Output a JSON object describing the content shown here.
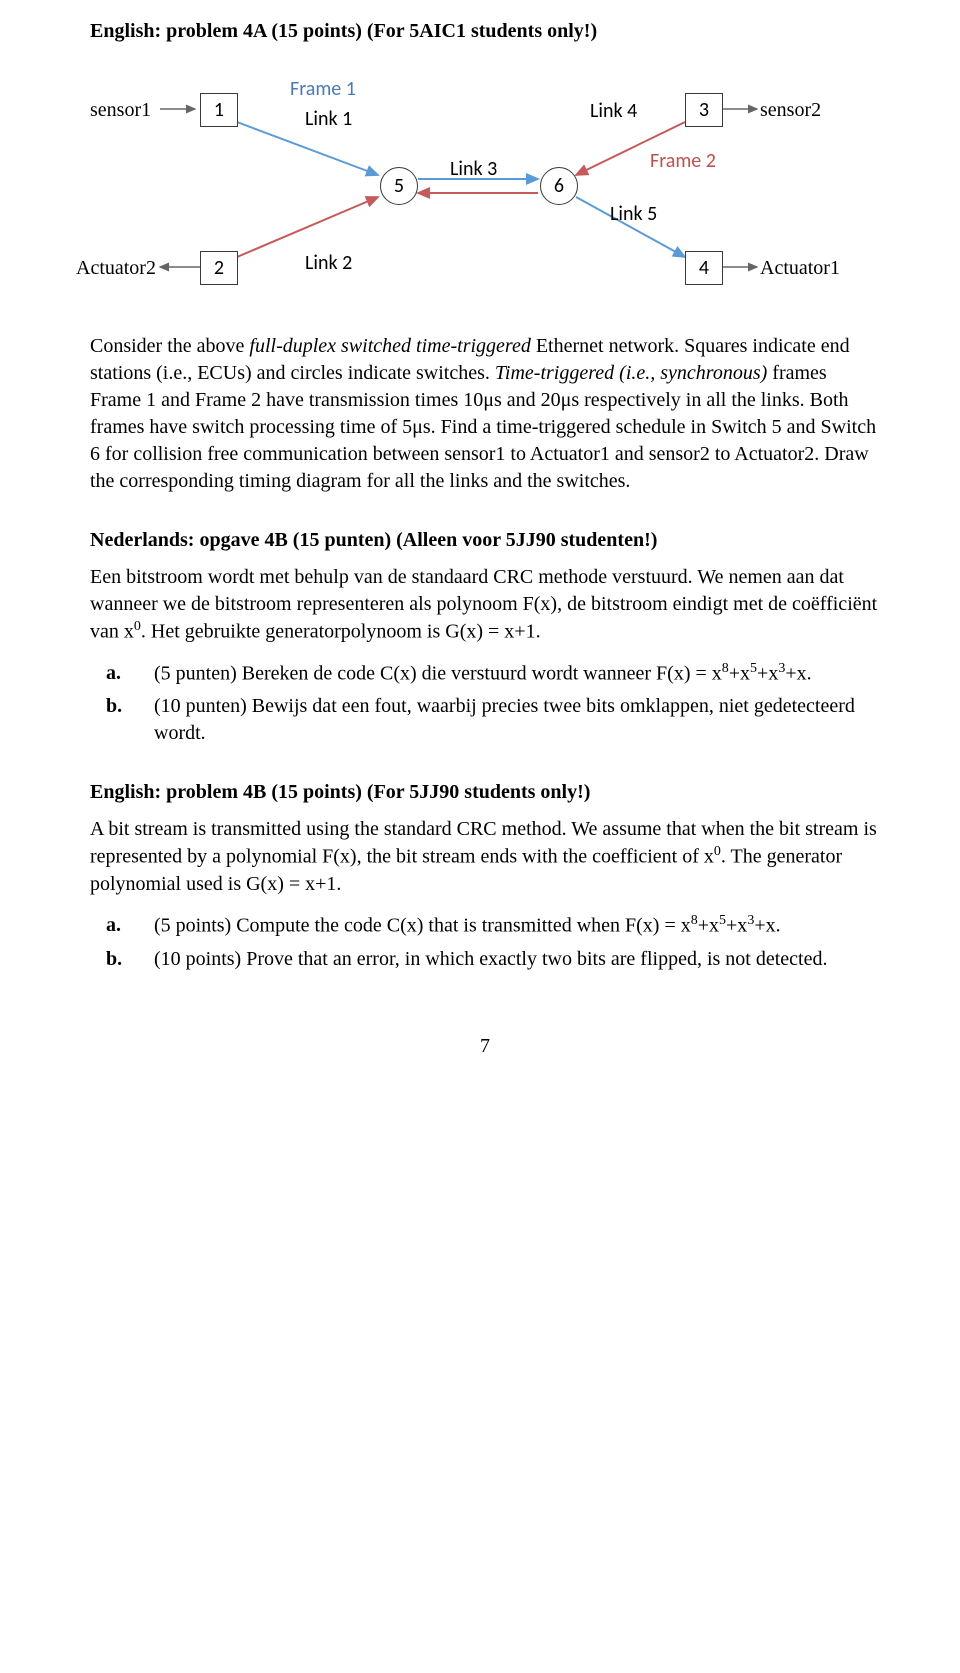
{
  "title4A_en": "English: problem 4A (15 points) (For 5AIC1 students only!)",
  "diagram": {
    "sensor1": "sensor1",
    "sensor2": "sensor2",
    "actuator1": "Actuator1",
    "actuator2": "Actuator2",
    "n1": "1",
    "n2": "2",
    "n3": "3",
    "n4": "4",
    "n5": "5",
    "n6": "6",
    "frame1": "Frame 1",
    "frame2": "Frame 2",
    "link1": "Link 1",
    "link2": "Link 2",
    "link3": "Link 3",
    "link4": "Link 4",
    "link5": "Link 5"
  },
  "p4A_en_body": "Consider the above full-duplex switched time-triggered Ethernet network. Squares indicate end stations (i.e., ECUs) and circles indicate switches. Time-triggered (i.e., synchronous) frames Frame 1 and Frame 2 have transmission times 10μs and 20μs respectively in all the links. Both frames have switch processing time of 5μs. Find a time-triggered schedule in Switch 5 and Switch 6 for collision free communication between sensor1 to Actuator1 and sensor2 to Actuator2. Draw the corresponding timing diagram for all the links and the switches.",
  "title4B_nl": "Nederlands: opgave 4B (15 punten) (Alleen voor 5JJ90 studenten!)",
  "p4B_nl_intro_1": "Een bitstroom wordt met behulp van de standaard CRC methode verstuurd. We nemen aan dat wanneer we de bitstroom representeren als polynoom F(x), de bitstroom eindigt met de coëfficiënt van x",
  "p4B_nl_intro_sup": "0",
  "p4B_nl_intro_2": ". Het gebruikte generatorpolynoom is G(x) = x+1.",
  "p4B_nl_a_1": "(5 punten) Bereken de code C(x) die verstuurd wordt wanneer F(x) = x",
  "p4B_nl_a_sup1": "8",
  "p4B_nl_a_2": "+x",
  "p4B_nl_a_sup2": "5",
  "p4B_nl_a_3": "+x",
  "p4B_nl_a_sup3": "3",
  "p4B_nl_a_4": "+x.",
  "p4B_nl_b": "(10 punten) Bewijs dat een fout, waarbij precies twee bits omklappen, niet gedetecteerd wordt.",
  "title4B_en": "English: problem 4B (15 points) (For 5JJ90 students only!)",
  "p4B_en_intro_1": "A bit stream is transmitted using the standard CRC method. We assume that when the bit stream is represented by a polynomial F(x), the bit stream ends with the coefficient of x",
  "p4B_en_intro_sup": "0",
  "p4B_en_intro_2": ". The generator polynomial used is G(x) = x+1.",
  "p4B_en_a_1": "(5 points) Compute the code C(x) that is transmitted when F(x) = x",
  "p4B_en_a_sup1": "8",
  "p4B_en_a_2": "+x",
  "p4B_en_a_sup2": "5",
  "p4B_en_a_3": "+x",
  "p4B_en_a_sup3": "3",
  "p4B_en_a_4": "+x.",
  "p4B_en_b": "(10 points) Prove that an error, in which exactly two bits are flipped, is not detected.",
  "label_a": "a.",
  "label_b": "b.",
  "pageno": "7"
}
